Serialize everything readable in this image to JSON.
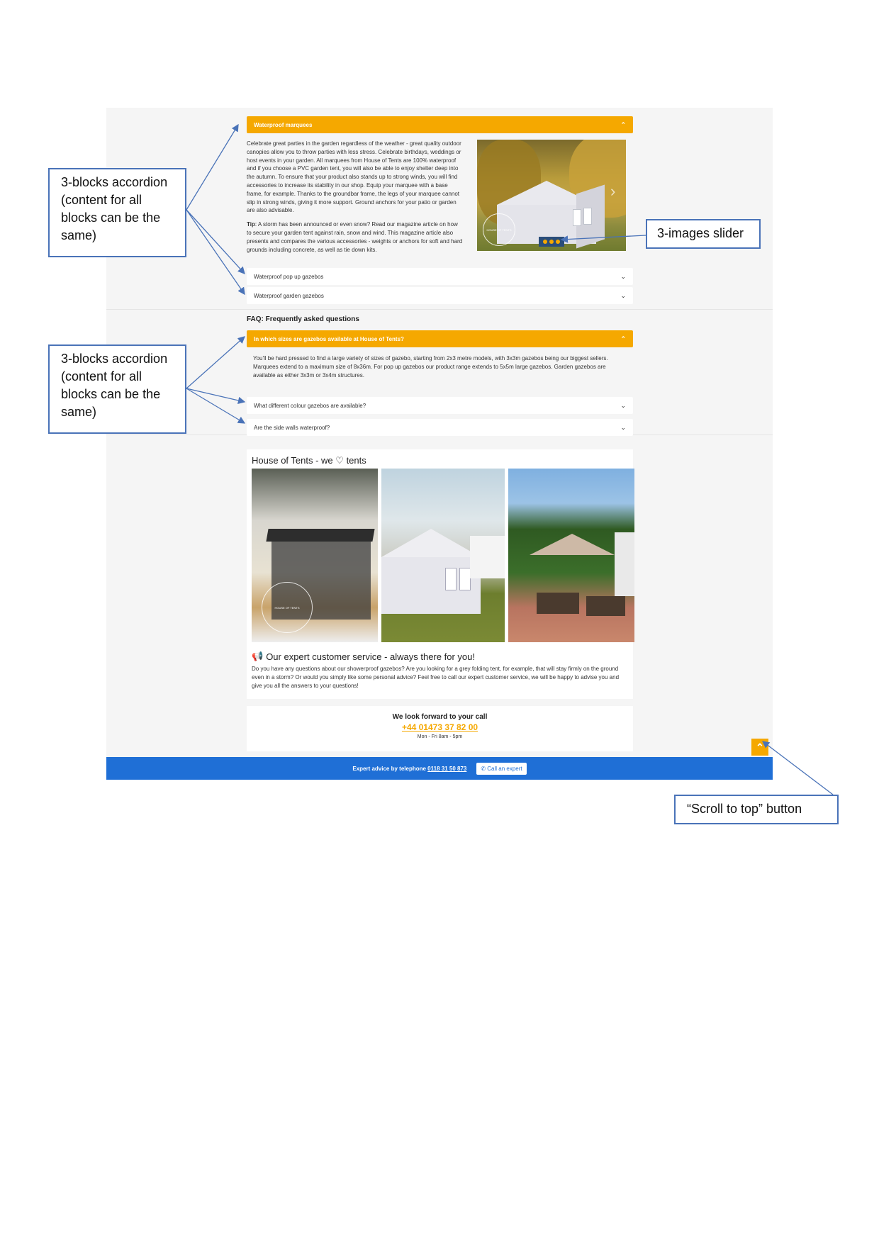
{
  "accordion_1": {
    "items": [
      {
        "title": "Waterproof marquees",
        "open": true
      },
      {
        "title": "Waterproof pop up gazebos",
        "open": false
      },
      {
        "title": "Waterproof garden gazebos",
        "open": false
      }
    ],
    "body_paragraph": "Celebrate great parties in the garden regardless of the weather - great quality outdoor canopies allow you to throw parties with less stress. Celebrate birthdays, weddings or host events in your garden. All marquees from House of Tents are 100% waterproof and if you choose a PVC garden tent, you will also be able to enjoy shelter deep into the autumn. To ensure that your product also stands up to strong winds, you will find accessories to increase its stability in our shop. Equip your marquee with a base frame, for example. Thanks to the groundbar frame, the legs of your marquee cannot slip in strong winds, giving it more support. Ground anchors for your patio or garden are also advisable.",
    "tip_label": "Tip",
    "tip_text": ": A storm has been announced or even snow? Read our magazine article on how to secure your garden tent against rain, snow and wind. This magazine article also presents and compares the various accessories - weights or anchors for soft and hard grounds including concrete, as well as tie down kits.",
    "slider_watermark": "HOUSE OF TENTS"
  },
  "faq": {
    "heading": "FAQ: Frequently asked questions",
    "items": [
      {
        "title": "In which sizes are gazebos available at House of Tents?",
        "open": true
      },
      {
        "title": "What different colour gazebos are available?",
        "open": false
      },
      {
        "title": "Are the side walls waterproof?",
        "open": false
      }
    ],
    "body": "You'll be hard pressed to find a large variety of sizes of gazebo, starting from 2x3 metre models, with 3x3m gazebos being our biggest sellers. Marquees extend to a maximum size of 8x36m. For pop up gazebos our product range extends to 5x5m large gazebos. Garden gazebos are available as either 3x3m or 3x4m structures."
  },
  "gallery": {
    "title_prefix": "House of Tents - we",
    "heart": "♡",
    "title_suffix": "tents",
    "watermark": "HOUSE OF TENTS"
  },
  "service": {
    "heading": "Our expert customer service - always there for you!",
    "icon": "megaphone-icon",
    "body": "Do you have any questions about our showerproof gazebos? Are you looking for a grey folding tent, for example, that will stay firmly on the ground even in a storm? Or would you simply like some personal advice? Feel free to call our expert customer service, we will be happy to advise you and give you all the answers to your questions!"
  },
  "call": {
    "heading": "We look forward to your call",
    "phone": "+44 01473 37 82 00",
    "hours": "Mon - Fri 8am - 5pm"
  },
  "cta_bar": {
    "text": "Expert advice by telephone",
    "phone": "0118 31 50 873",
    "button": "Call an expert"
  },
  "annotations": {
    "accordion_note_1": "3-blocks accordion (content for all blocks can be the same)",
    "accordion_note_2": "3-blocks accordion (content for all blocks can be the same)",
    "slider_note": "3-images slider",
    "scroll_note": "“Scroll to top” button"
  },
  "colors": {
    "accent": "#f5a800",
    "cta_blue": "#1f6fd6",
    "annotation_border": "#4a73b8",
    "page_bg": "#f5f5f5"
  }
}
